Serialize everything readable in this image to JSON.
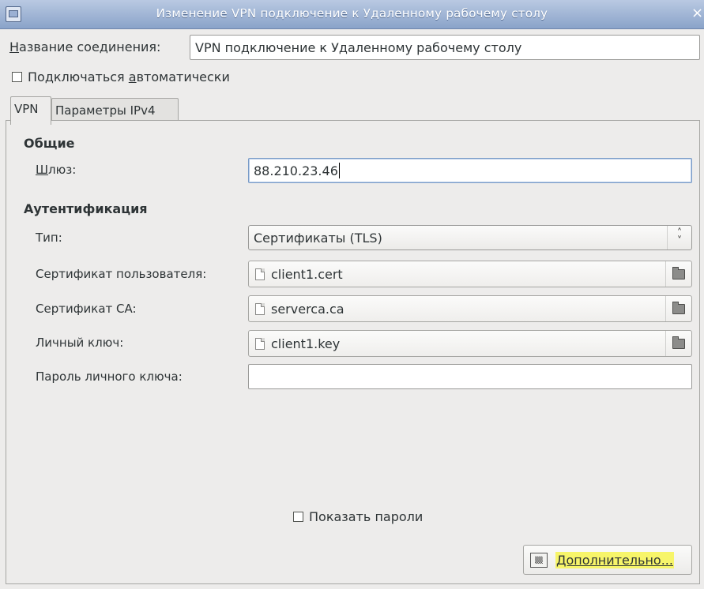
{
  "window": {
    "title": "Изменение VPN подключение к Удаленному рабочему столу",
    "close_glyph": "×"
  },
  "connection_name": {
    "label_first": "Н",
    "label_rest": "азвание соединения:",
    "value": "VPN подключение к Удаленному рабочему столу"
  },
  "auto_connect": {
    "label_before": "Подключаться ",
    "label_underlined": "а",
    "label_after": "втоматически",
    "checked": false
  },
  "tabs": [
    {
      "label": "VPN",
      "active": true
    },
    {
      "label": "Параметры IPv4",
      "active": false
    }
  ],
  "general": {
    "heading": "Общие",
    "gateway_label_first": "Ш",
    "gateway_label_rest": "люз:",
    "gateway_value": "88.210.23.46"
  },
  "auth": {
    "heading": "Аутентификация",
    "type_label": "Тип:",
    "type_value": "Сертификаты (TLS)",
    "type_arrow": "⌃⌄",
    "user_cert_label": "Сертификат пользователя:",
    "user_cert_file": "client1.cert",
    "ca_cert_label": "Сертификат CA:",
    "ca_cert_file": "serverca.ca",
    "private_key_label": "Личный ключ:",
    "private_key_file": "client1.key",
    "key_password_label": "Пароль личного ключа:",
    "key_password_value": ""
  },
  "show_passwords": {
    "label": "Показать пароли",
    "checked": false
  },
  "advanced_button": {
    "icon_text": "▒▒",
    "label": "Дополнительно..."
  },
  "colors": {
    "highlight": "#f7f56a",
    "titlebar": "#8aa3c9"
  }
}
